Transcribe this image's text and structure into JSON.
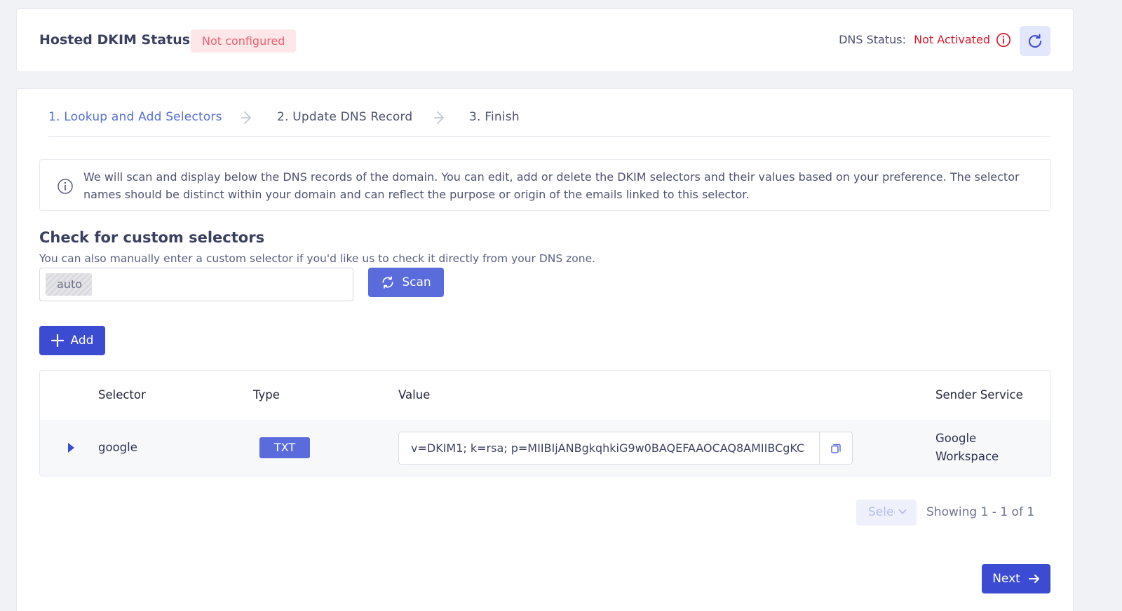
{
  "header": {
    "title": "Hosted DKIM Status",
    "status_badge": "Not configured",
    "dns_status_label": "DNS Status:",
    "dns_status_value": "Not Activated"
  },
  "steps": [
    {
      "label": "1. Lookup and Add Selectors",
      "active": true
    },
    {
      "label": "2. Update DNS Record",
      "active": false
    },
    {
      "label": "3. Finish",
      "active": false
    }
  ],
  "info": {
    "text": "We will scan and display below the DNS records of the domain. You can edit, add or delete the DKIM selectors and their values based on your preference. The selector names should be distinct within your domain and can reflect the purpose or origin of the emails linked to this selector."
  },
  "custom_selectors": {
    "title": "Check for custom selectors",
    "subtitle": "You can also manually enter a custom selector if you'd like us to check it directly from your DNS zone.",
    "chip": "auto",
    "scan_label": "Scan"
  },
  "add_label": "Add",
  "table": {
    "headers": [
      "Selector",
      "Type",
      "Value",
      "Sender Service"
    ],
    "rows": [
      {
        "selector": "google",
        "type": "TXT",
        "value": "v=DKIM1; k=rsa; p=MIIBIjANBgkqhkiG9w0BAQEFAAOCAQ8AMIIBCgKC",
        "sender_service": "Google Workspace"
      }
    ]
  },
  "pagination": {
    "page_size_placeholder": "Select",
    "showing": "Showing 1 - 1 of 1"
  },
  "next_label": "Next",
  "colors": {
    "primary": "#3b4cd2",
    "accent": "#5a6bdc",
    "active_step": "#5670d8",
    "danger": "#e0162b"
  }
}
